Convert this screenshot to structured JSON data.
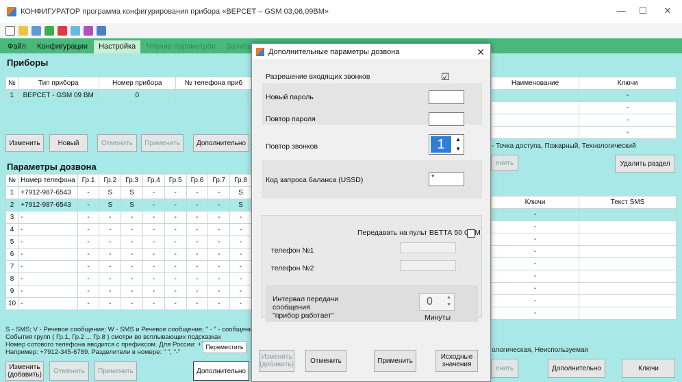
{
  "window": {
    "title": "КОНФИГУРАТОР программа конфигурирования прибора «ВЕРСЕТ – GSM 03,06,09ВМ»",
    "minimize": "—",
    "maximize": "☐",
    "close": "✕"
  },
  "menu": {
    "items": [
      {
        "label": "Файл"
      },
      {
        "label": "Конфигурации"
      },
      {
        "label": "Настройка"
      },
      {
        "label": "Чтение параметров"
      },
      {
        "label": "Запись пара"
      }
    ]
  },
  "devices": {
    "title": "Приборы",
    "headers": [
      "№",
      "Тип прибора",
      "Номер прибора",
      "№ телефона приб"
    ],
    "row": {
      "n": "1",
      "type": "ВЕРСЕТ - GSM 09 ВМ",
      "number": "0",
      "phone": ""
    },
    "buttons": {
      "edit": "Изменить",
      "new": "Новый",
      "cancel": "Отменить",
      "apply": "Применить",
      "more": "Дополнительно"
    }
  },
  "dial": {
    "title": "Параметры дозвона",
    "headers": [
      "№",
      "Номер телефона",
      "Гр.1",
      "Гр.2",
      "Гр.3",
      "Гр.4",
      "Гр.5",
      "Гр.6",
      "Гр.7",
      "Гр.8"
    ],
    "rows": [
      [
        "1",
        "+7912-987-6543",
        "-",
        "S",
        "S",
        "-",
        "-",
        "-",
        "-",
        "S"
      ],
      [
        "2",
        "+7912-987-6543",
        "-",
        "S",
        "S",
        "-",
        "-",
        "-",
        "-",
        "S"
      ],
      [
        "3",
        "-",
        "-",
        "-",
        "-",
        "-",
        "-",
        "-",
        "-",
        "-"
      ],
      [
        "4",
        "-",
        "-",
        "-",
        "-",
        "-",
        "-",
        "-",
        "-",
        "-"
      ],
      [
        "5",
        "-",
        "-",
        "-",
        "-",
        "-",
        "-",
        "-",
        "-",
        "-"
      ],
      [
        "6",
        "-",
        "-",
        "-",
        "-",
        "-",
        "-",
        "-",
        "-",
        "-"
      ],
      [
        "7",
        "-",
        "-",
        "-",
        "-",
        "-",
        "-",
        "-",
        "-",
        "-"
      ],
      [
        "8",
        "-",
        "-",
        "-",
        "-",
        "-",
        "-",
        "-",
        "-",
        "-"
      ],
      [
        "9",
        "-",
        "-",
        "-",
        "-",
        "-",
        "-",
        "-",
        "-",
        "-"
      ],
      [
        "10",
        "-",
        "-",
        "-",
        "-",
        "-",
        "-",
        "-",
        "-",
        "-"
      ]
    ],
    "notes": [
      "S - SMS;  V - Речевое сообщение;  W - SMS и Речевое сообщение; \" - \" - сообщения",
      "События групп { Гр.1, Гр.2 ... Гр.8 } смотри во всплывающих подсказках",
      "Номер сотового телефона вводится с префиксом. Для России: +7;",
      "Например: +7912-345-6789. Разделители в номере: \" \", \"-\""
    ],
    "move_button": "Переместить",
    "buttons": {
      "edit": "Изменить (добавить)",
      "cancel": "Отменить",
      "apply": "Применить",
      "more": "Дополнительно"
    }
  },
  "right_top": {
    "headers": [
      "Наименование",
      "Ключи"
    ],
    "rows": [
      [
        "",
        "-"
      ],
      [
        "",
        "-"
      ],
      [
        "",
        "-"
      ],
      [
        "",
        "-"
      ]
    ],
    "caption": "- Точка доступа, Пожарный, Технологический",
    "partial_button": "енить",
    "delete_section": "Удалить раздел"
  },
  "right_bottom": {
    "headers": [
      "Ключи",
      "Текст SMS"
    ],
    "rows": [
      [
        "-",
        ""
      ],
      [
        "-",
        ""
      ],
      [
        "-",
        ""
      ],
      [
        "-",
        ""
      ],
      [
        "-",
        ""
      ],
      [
        "-",
        ""
      ],
      [
        "-",
        ""
      ],
      [
        "-",
        ""
      ],
      [
        "-",
        ""
      ]
    ],
    "caption": "ологическая, Неиспользуемая",
    "partial_button": "енить",
    "more": "Дополнительно",
    "keys": "Ключи"
  },
  "dialog": {
    "title": "Дополнительные параметры дозвона",
    "close": "✕",
    "allow_incoming": "Разрешение входящих звонков",
    "allow_incoming_checked": "☑",
    "new_password": "Новый пароль",
    "repeat_password": "Повтор пароля",
    "repeat_calls": "Повтор звонков",
    "repeat_calls_value": "1",
    "balance_code": "Код запроса баланса (USSD)",
    "balance_code_value": "*",
    "send_to_console": "Передавать на пульт ВЕТТА 50 GSM",
    "phone1": "телефон №1",
    "phone2": "телефон №2",
    "interval_label_1": "Интервал передачи",
    "interval_label_2": "сообщения",
    "interval_label_3": "\"прибор работает\"",
    "interval_value": "0",
    "minutes": "Минуты",
    "buttons": {
      "edit": "Изменить (добавить)",
      "cancel": "Отменить",
      "apply": "Применить",
      "defaults": "Исходные значения"
    }
  }
}
